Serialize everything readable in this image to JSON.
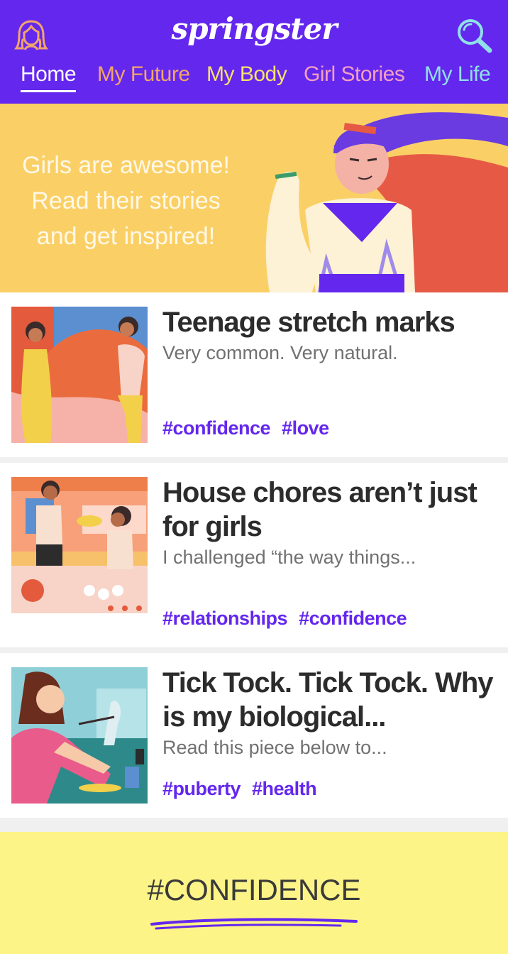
{
  "header": {
    "logo": "springster",
    "brand_color": "#6427ee",
    "nav": [
      {
        "label": "Home",
        "color": "#ffffff",
        "active": true
      },
      {
        "label": "My Future",
        "color": "#f2a56a",
        "active": false
      },
      {
        "label": "My Body",
        "color": "#f7e06c",
        "active": false
      },
      {
        "label": "Girl Stories",
        "color": "#f2a0c0",
        "active": false
      },
      {
        "label": "My Life",
        "color": "#8fe0e8",
        "active": false
      }
    ],
    "icons": {
      "profile": "profile-girl-icon",
      "search": "search-icon"
    }
  },
  "hero": {
    "lines": [
      "Girls are awesome!",
      "Read their stories",
      "and get inspired!"
    ]
  },
  "articles": [
    {
      "title": "Teenage stretch marks",
      "subtitle": "Very common. Very natural.",
      "tags": [
        "#confidence",
        "#love"
      ]
    },
    {
      "title": "House chores aren’t just for girls",
      "subtitle": "I challenged “the way things...",
      "tags": [
        "#relationships",
        "#confidence"
      ]
    },
    {
      "title": "Tick Tock. Tick Tock. Why is my biological...",
      "subtitle": "Read this piece below to...",
      "tags": [
        "#puberty",
        "#health"
      ]
    }
  ],
  "confidence_section": {
    "title": "#CONFIDENCE"
  }
}
